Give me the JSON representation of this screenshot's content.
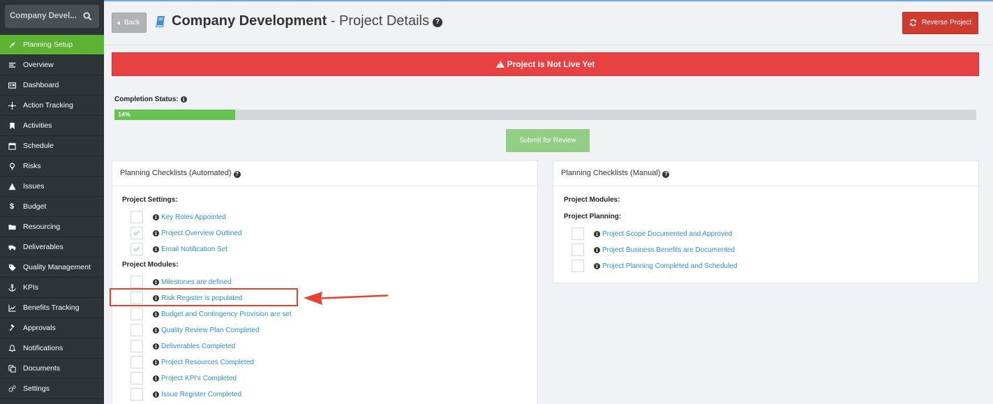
{
  "sidebar": {
    "search_text": "Company Devel...",
    "items": [
      {
        "label": "Planning Setup",
        "icon": "rocket-icon",
        "active": true
      },
      {
        "label": "Overview",
        "icon": "align-left-icon"
      },
      {
        "label": "Dashboard",
        "icon": "dashboard-icon"
      },
      {
        "label": "Action Tracking",
        "icon": "crosshair-icon"
      },
      {
        "label": "Activities",
        "icon": "bookmark-icon"
      },
      {
        "label": "Schedule",
        "icon": "calendar-icon"
      },
      {
        "label": "Risks",
        "icon": "lightbulb-icon"
      },
      {
        "label": "Issues",
        "icon": "warning-icon"
      },
      {
        "label": "Budget",
        "icon": "dollar-icon"
      },
      {
        "label": "Resourcing",
        "icon": "folder-icon"
      },
      {
        "label": "Deliverables",
        "icon": "truck-icon"
      },
      {
        "label": "Quality Management",
        "icon": "tag-icon"
      },
      {
        "label": "KPIs",
        "icon": "anchor-icon"
      },
      {
        "label": "Benefits Tracking",
        "icon": "line-chart-icon"
      },
      {
        "label": "Approvals",
        "icon": "gavel-icon"
      },
      {
        "label": "Notifications",
        "icon": "bell-icon"
      },
      {
        "label": "Documents",
        "icon": "copy-icon"
      },
      {
        "label": "Settings",
        "icon": "cogs-icon"
      }
    ]
  },
  "header": {
    "back_label": "Back",
    "title_bold": "Company Development",
    "title_rest": " - Project Details",
    "reverse_label": "Reverse Project"
  },
  "alert": {
    "text": "Project is Not Live Yet",
    "color": "#e74142"
  },
  "completion": {
    "label": "Completion Status:",
    "percent": 14,
    "percent_text": "14%"
  },
  "submit_label": "Submit for Review",
  "automated": {
    "title": "Planning Checklists (Automated)",
    "sections": [
      {
        "title": "Project Settings:",
        "items": [
          {
            "label": "Key Roles Appointed",
            "checked": false
          },
          {
            "label": "Project Overview Outlined",
            "checked": true
          },
          {
            "label": "Email Notification Set",
            "checked": true
          }
        ]
      },
      {
        "title": "Project Modules:",
        "items": [
          {
            "label": "Milestones are defined",
            "checked": false
          },
          {
            "label": "Risk Register is populated",
            "checked": false
          },
          {
            "label": "Budget and Contingency Provision are set",
            "checked": false
          },
          {
            "label": "Quality Review Plan Completed",
            "checked": false
          },
          {
            "label": "Deliverables Completed",
            "checked": false
          },
          {
            "label": "Project Resources Completed",
            "checked": false
          },
          {
            "label": "Project KPI's Completed",
            "checked": false
          },
          {
            "label": "Issue Register Completed",
            "checked": false
          }
        ]
      }
    ]
  },
  "manual": {
    "title": "Planning Checklists (Manual)",
    "sections": [
      {
        "title": "Project Modules:",
        "items": []
      },
      {
        "title": "Project Planning:",
        "items": [
          {
            "label": "Project Scope Documented and Approved",
            "checked": false
          },
          {
            "label": "Project Business Benefits are Documented",
            "checked": false
          },
          {
            "label": "Project Planning Completed and Scheduled",
            "checked": false
          }
        ]
      }
    ]
  }
}
